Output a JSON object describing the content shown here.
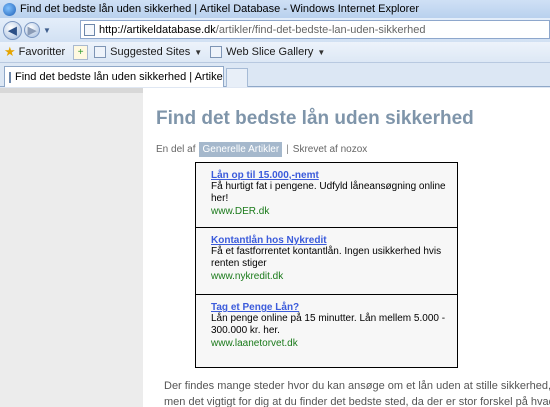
{
  "window": {
    "title": "Find det bedste lån uden sikkerhed | Artikel Database - Windows Internet Explorer"
  },
  "address": {
    "host": "http://artikeldatabase.dk",
    "path": "/artikler/find-det-bedste-lan-uden-sikkerhed"
  },
  "favorites": {
    "favoritter": "Favoritter",
    "suggested": "Suggested Sites",
    "webslice": "Web Slice Gallery"
  },
  "tab": {
    "label": "Find det bedste lån uden sikkerhed | Artikel Datab..."
  },
  "article": {
    "title": "Find det bedste lån uden sikkerhed",
    "prefix": "En del af",
    "category": "Generelle Artikler",
    "separator": "|",
    "author": "Skrevet af nozox"
  },
  "ads": [
    {
      "title": "Lån op til 15.000,-nemt",
      "desc": "Få hurtigt fat i pengene. Udfyld låneansøgning online her!",
      "url": "www.DER.dk"
    },
    {
      "title": "Kontantlån hos Nykredit",
      "desc": "Få et fastforrentet kontantlån. Ingen usikkerhed hvis renten stiger",
      "url": "www.nykredit.dk"
    },
    {
      "title": "Tag et Penge Lån?",
      "desc": "Lån penge online på 15 minutter. Lån mellem 5.000 - 300.000 kr. her.",
      "url": "www.laanetorvet.dk"
    }
  ],
  "body": {
    "line1": "Der findes mange steder hvor du kan ansøge om et lån uden at stille sikkerhed,",
    "line2": "men det vigtigt for dig at du finder det bedste sted, da der er stor forskel på hvad"
  }
}
